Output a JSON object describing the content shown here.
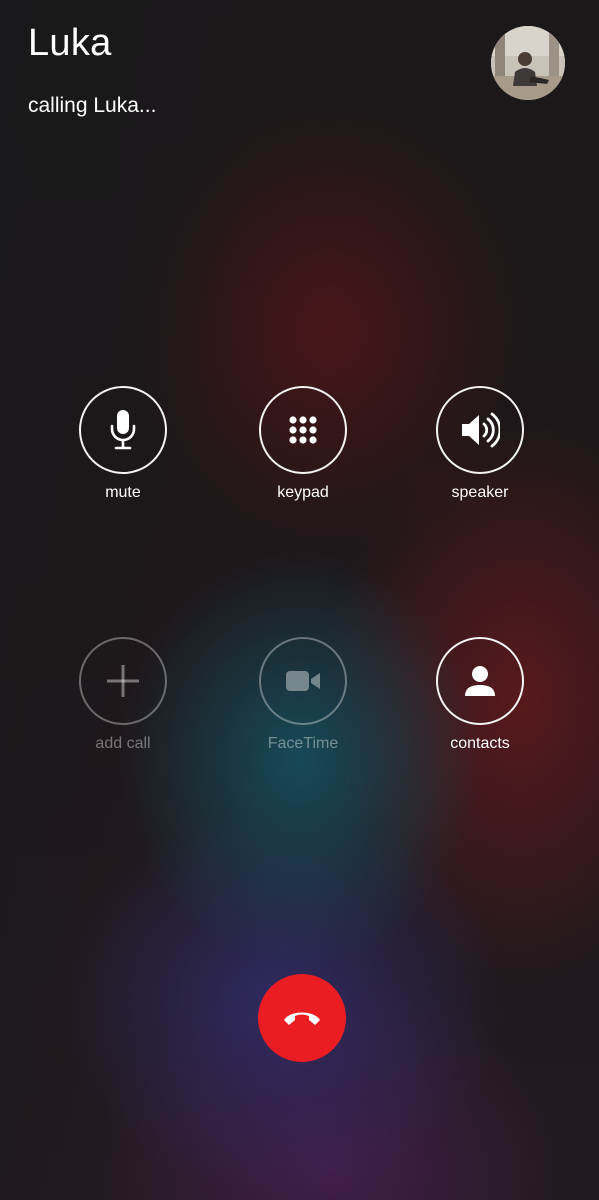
{
  "caller": {
    "name": "Luka",
    "status": "calling Luka..."
  },
  "controls": {
    "row1": [
      {
        "label": "mute",
        "icon": "microphone-icon",
        "enabled": true
      },
      {
        "label": "keypad",
        "icon": "keypad-grid-icon",
        "enabled": true
      },
      {
        "label": "speaker",
        "icon": "speaker-icon",
        "enabled": true
      }
    ],
    "row2": [
      {
        "label": "add call",
        "icon": "plus-icon",
        "enabled": false
      },
      {
        "label": "FaceTime",
        "icon": "video-camera-icon",
        "enabled": false
      },
      {
        "label": "contacts",
        "icon": "person-icon",
        "enabled": true
      }
    ]
  },
  "end_call": {
    "icon": "phone-hangup-icon",
    "color": "#ea1d23"
  }
}
